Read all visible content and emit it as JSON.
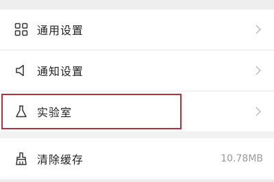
{
  "settings": {
    "items": [
      {
        "label": "通用设置",
        "icon": "grid-icon",
        "has_chevron": true
      },
      {
        "label": "通知设置",
        "icon": "speaker-icon",
        "has_chevron": true
      },
      {
        "label": "实验室",
        "icon": "flask-icon",
        "has_chevron": true
      },
      {
        "label": "清除缓存",
        "icon": "broom-icon",
        "value": "10.78MB"
      }
    ]
  },
  "colors": {
    "highlight_border": "#b1303c",
    "label_text": "#222222",
    "secondary_text": "#999999",
    "icon_stroke": "#333333",
    "chevron": "#bbbbbb"
  }
}
